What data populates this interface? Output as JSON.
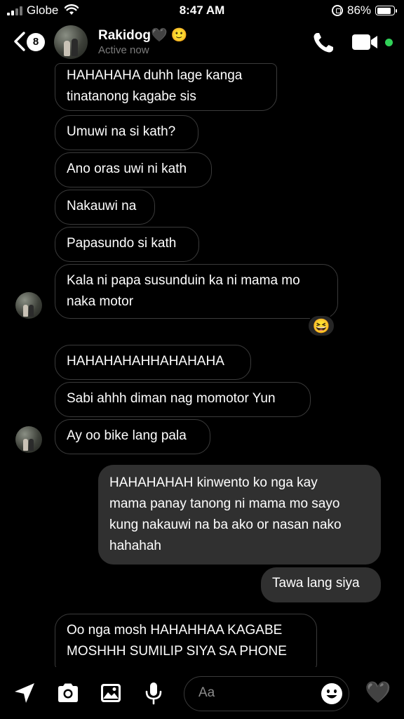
{
  "status_bar": {
    "carrier": "Globe",
    "time": "8:47 AM",
    "battery": "86%",
    "battery_level": 0.86
  },
  "header": {
    "unread_count": "8",
    "contact_name": "Rakidog🖤 🙂",
    "status": "Active now"
  },
  "messages": [
    {
      "dir": "in",
      "text": "HAHAHAHA duhh lage kanga\ntinatanong kagabe sis"
    },
    {
      "dir": "in",
      "text": "Umuwi na si kath?"
    },
    {
      "dir": "in",
      "text": "Ano oras uwi ni kath"
    },
    {
      "dir": "in",
      "text": "Nakauwi na"
    },
    {
      "dir": "in",
      "text": "Papasundo si kath"
    },
    {
      "dir": "in",
      "text": "Kala ni papa susunduin ka ni mama mo\nnaka motor",
      "reaction": "😆"
    },
    {
      "dir": "in",
      "text": "HAHAHAHAHHAHAHAHA"
    },
    {
      "dir": "in",
      "text": "Sabi ahhh diman nag momotor Yun"
    },
    {
      "dir": "in",
      "text": "Ay oo bike lang pala"
    },
    {
      "dir": "out",
      "text": "HAHAHAHAH kinwento ko nga kay\nmama panay tanong ni mama mo sayo\nkung nakauwi na ba ako or nasan nako\nhahahah"
    },
    {
      "dir": "out",
      "text": "Tawa lang siya"
    },
    {
      "dir": "in",
      "text": "Oo nga mosh HAHAHHAA KAGABE\nMOSHHH SUMILIP SIYA SA PHONE"
    }
  ],
  "composer": {
    "placeholder": "Aa",
    "like_emoji": "🖤",
    "icons": [
      "location-arrow-icon",
      "camera-icon",
      "gallery-icon",
      "microphone-icon",
      "emoji-icon",
      "heart-icon"
    ]
  }
}
